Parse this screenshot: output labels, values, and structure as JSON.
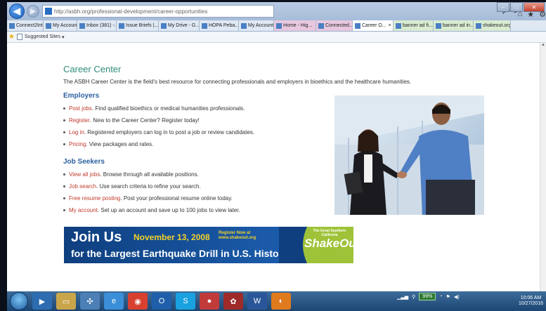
{
  "browser": {
    "url": "http://asbh.org/professional-development/career-opportunities",
    "url_host": "asbh.org",
    "tabs": [
      {
        "label": "Connect2Int...",
        "style": "normal"
      },
      {
        "label": "My Account",
        "style": "normal"
      },
      {
        "label": "Inbox (381) -...",
        "style": "normal"
      },
      {
        "label": "Issue Briefs |...",
        "style": "normal"
      },
      {
        "label": "My Drive - G...",
        "style": "normal"
      },
      {
        "label": "HOPA Peba...",
        "style": "normal"
      },
      {
        "label": "My Account",
        "style": "normal"
      },
      {
        "label": "Home - Hig...",
        "style": "pink"
      },
      {
        "label": "Connected...",
        "style": "pink"
      },
      {
        "label": "Career O...",
        "style": "active"
      },
      {
        "label": "banner ad fi...",
        "style": "green"
      },
      {
        "label": "banner ad in...",
        "style": "green"
      },
      {
        "label": "shakeout.org",
        "style": "green"
      }
    ],
    "favorites": {
      "suggested_sites": "Suggested Sites"
    },
    "search_glyphs": "ρ - C",
    "tab_close": "×",
    "toolbar_icons": [
      "home-icon",
      "star-icon",
      "gear-icon"
    ]
  },
  "page": {
    "title": "Career Center",
    "intro": "The ASBH Career Center is the field's best resource for connecting professionals and employers in bioethics and the healthcare humanities.",
    "employers": {
      "heading": "Employers",
      "items": [
        {
          "link": "Post jobs",
          "text": ". Find qualified bioethics or medical humanities professionals."
        },
        {
          "link": "Register",
          "text": ". New to the Career Center? Register today!"
        },
        {
          "link": "Log in",
          "text": ". Registered employers can log in to post a job or review candidates."
        },
        {
          "link": "Pricing",
          "text": ". View packages and rates."
        }
      ]
    },
    "job_seekers": {
      "heading": "Job Seekers",
      "items": [
        {
          "link": "View all jobs",
          "text": ". Browse through all available positions."
        },
        {
          "link": "Job search",
          "text": ". Use search criteria to refine your search."
        },
        {
          "link": "Free resume posting",
          "text": ". Post your professional resume online today."
        },
        {
          "link": "My account",
          "text": ". Set up an account and save up to 100 jobs to view later."
        }
      ]
    },
    "banner": {
      "join": "Join Us",
      "date": "November 13, 2008",
      "register_line1": "Register Now at",
      "register_line2": "www.shakeout.org",
      "subline": "for the Largest Earthquake Drill in U.S. History.",
      "logo_small": "The Great Southern California",
      "logo_big": "ShakeOut"
    }
  },
  "taskbar": {
    "battery": "99%",
    "time": "10:06 AM",
    "date": "10/27/2016"
  },
  "colors": {
    "heading_teal": "#2f8c7c",
    "subheading_blue": "#2a5f9e",
    "link_red": "#c0392b",
    "banner_blue": "#1a5aa8",
    "banner_yellow": "#f3d12a",
    "logo_green": "#9ec338"
  }
}
